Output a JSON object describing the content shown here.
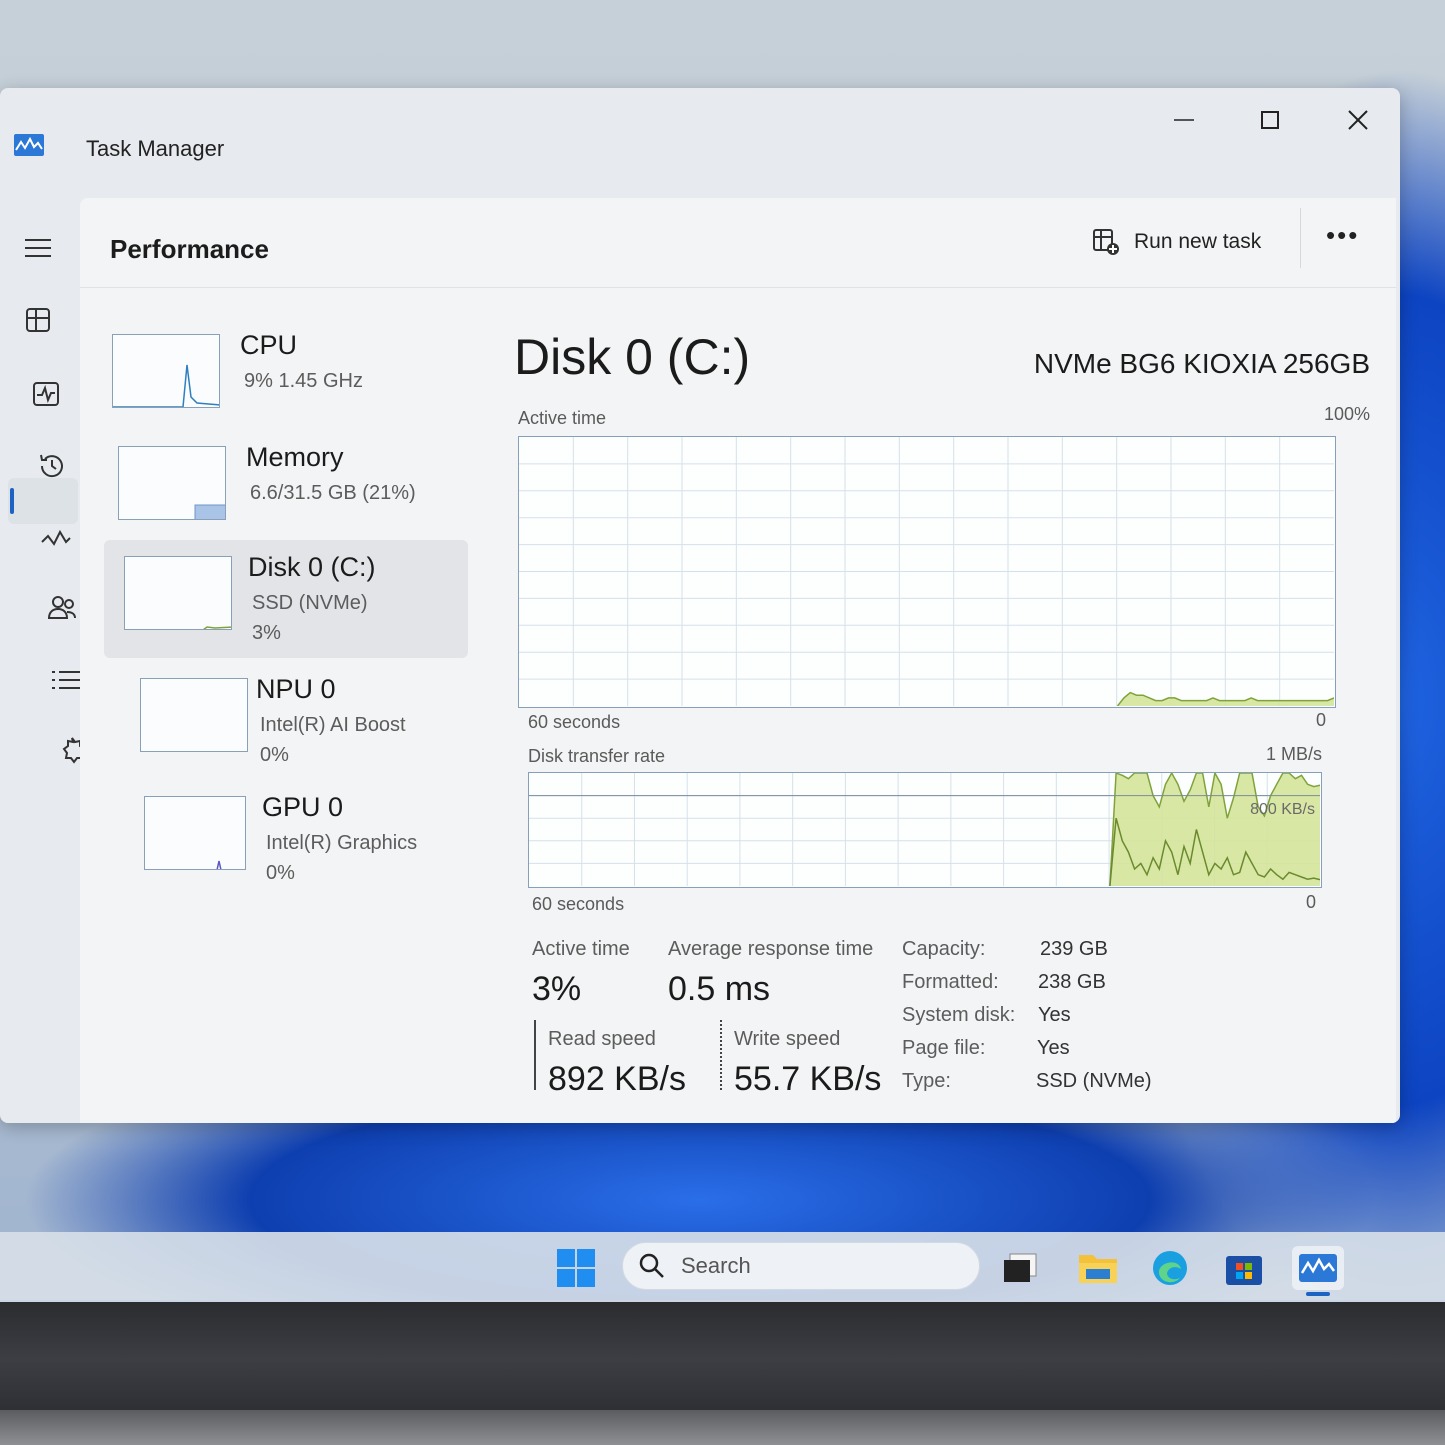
{
  "window": {
    "title": "Task Manager"
  },
  "header": {
    "page_title": "Performance",
    "run_task_label": "Run new task",
    "more_label": "•••"
  },
  "devices": [
    {
      "name": "CPU",
      "sub": "9%  1.45 GHz",
      "sub2": ""
    },
    {
      "name": "Memory",
      "sub": "6.6/31.5 GB (21%)",
      "sub2": ""
    },
    {
      "name": "Disk 0 (C:)",
      "sub": "SSD (NVMe)",
      "sub2": "3%"
    },
    {
      "name": "NPU 0",
      "sub": "Intel(R) AI Boost",
      "sub2": "0%"
    },
    {
      "name": "GPU 0",
      "sub": "Intel(R) Graphics",
      "sub2": "0%"
    }
  ],
  "main": {
    "title": "Disk 0 (C:)",
    "model": "NVMe BG6 KIOXIA 256GB",
    "active_chart": {
      "label": "Active time",
      "max": "100%",
      "time": "60 seconds",
      "min": "0"
    },
    "transfer_chart": {
      "label": "Disk transfer rate",
      "max": "1 MB/s",
      "mid": "800 KB/s",
      "time": "60 seconds",
      "min": "0"
    }
  },
  "stats": {
    "active_time_label": "Active time",
    "active_time": "3%",
    "avg_response_label": "Average response time",
    "avg_response": "0.5 ms",
    "read_label": "Read speed",
    "read": "892 KB/s",
    "write_label": "Write speed",
    "write": "55.7 KB/s"
  },
  "properties": [
    {
      "k": "Capacity:",
      "v": "239 GB"
    },
    {
      "k": "Formatted:",
      "v": "238 GB"
    },
    {
      "k": "System disk:",
      "v": "Yes"
    },
    {
      "k": "Page file:",
      "v": "Yes"
    },
    {
      "k": "Type:",
      "v": "SSD (NVMe)"
    }
  ],
  "taskbar": {
    "search_placeholder": "Search"
  },
  "chart_data": [
    {
      "type": "area",
      "title": "Active time",
      "ylim": [
        0,
        100
      ],
      "x_range_seconds": 60,
      "values": [
        0,
        0,
        0,
        0,
        0,
        0,
        0,
        0,
        0,
        0,
        0,
        0,
        0,
        0,
        0,
        0,
        0,
        0,
        0,
        0,
        0,
        0,
        0,
        0,
        0,
        0,
        0,
        0,
        0,
        0,
        0,
        0,
        0,
        0,
        0,
        0,
        0,
        0,
        0,
        0,
        0,
        0,
        0,
        0,
        0,
        0,
        0,
        0,
        0,
        0,
        0,
        0,
        0,
        0,
        0,
        0,
        0,
        0,
        0,
        0,
        0,
        0,
        0,
        0,
        0,
        0,
        0,
        0,
        0,
        0,
        0,
        0,
        0,
        0,
        0,
        0,
        0,
        0,
        0,
        0,
        0,
        0,
        0,
        0,
        0,
        0,
        0,
        0,
        0,
        0,
        0,
        0,
        0,
        0,
        0,
        3,
        5,
        4,
        4,
        3,
        2,
        2,
        3,
        3,
        2,
        2,
        2,
        2,
        2,
        3,
        2,
        2,
        2,
        2,
        2,
        3,
        2,
        2,
        2,
        2,
        2,
        2,
        2,
        2,
        2,
        2,
        2,
        2,
        3
      ]
    },
    {
      "type": "area",
      "title": "Disk transfer rate",
      "ylim": [
        0,
        1000
      ],
      "x_range_seconds": 60,
      "series": [
        {
          "name": "Read speed",
          "values": [
            0,
            0,
            0,
            0,
            0,
            0,
            0,
            0,
            0,
            0,
            0,
            0,
            0,
            0,
            0,
            0,
            0,
            0,
            0,
            0,
            0,
            0,
            0,
            0,
            0,
            0,
            0,
            0,
            0,
            0,
            0,
            0,
            0,
            0,
            0,
            0,
            0,
            0,
            0,
            0,
            0,
            0,
            0,
            0,
            0,
            0,
            0,
            0,
            0,
            0,
            0,
            0,
            0,
            0,
            0,
            0,
            0,
            0,
            0,
            0,
            0,
            0,
            0,
            0,
            0,
            0,
            0,
            0,
            0,
            0,
            0,
            0,
            0,
            0,
            0,
            0,
            0,
            0,
            0,
            0,
            0,
            0,
            0,
            0,
            0,
            0,
            0,
            0,
            0,
            0,
            0,
            0,
            0,
            0,
            0,
            1000,
            980,
            950,
            1000,
            1000,
            1000,
            800,
            700,
            900,
            1000,
            900,
            750,
            850,
            1000,
            1000,
            700,
            1000,
            900,
            600,
            780,
            1000,
            1000,
            1000,
            700,
            620,
            800,
            900,
            1000,
            1000,
            950,
            980,
            900,
            880,
            892
          ]
        },
        {
          "name": "Write speed",
          "values": [
            0,
            0,
            0,
            0,
            0,
            0,
            0,
            0,
            0,
            0,
            0,
            0,
            0,
            0,
            0,
            0,
            0,
            0,
            0,
            0,
            0,
            0,
            0,
            0,
            0,
            0,
            0,
            0,
            0,
            0,
            0,
            0,
            0,
            0,
            0,
            0,
            0,
            0,
            0,
            0,
            0,
            0,
            0,
            0,
            0,
            0,
            0,
            0,
            0,
            0,
            0,
            0,
            0,
            0,
            0,
            0,
            0,
            0,
            0,
            0,
            0,
            0,
            0,
            0,
            0,
            0,
            0,
            0,
            0,
            0,
            0,
            0,
            0,
            0,
            0,
            0,
            0,
            0,
            0,
            0,
            0,
            0,
            0,
            0,
            0,
            0,
            0,
            0,
            0,
            0,
            0,
            0,
            0,
            0,
            0,
            600,
            400,
            300,
            150,
            200,
            100,
            250,
            150,
            400,
            300,
            100,
            350,
            200,
            500,
            300,
            100,
            200,
            150,
            250,
            100,
            120,
            300,
            200,
            100,
            80,
            150,
            100,
            60,
            120,
            100,
            80,
            60,
            70,
            56
          ]
        }
      ]
    }
  ],
  "colors": {
    "accent": "#1d63c4",
    "chart_border": "#86a0bc",
    "grid": "#d5e1ea",
    "fill": "#d4e49a",
    "line": "#7fa33a"
  }
}
